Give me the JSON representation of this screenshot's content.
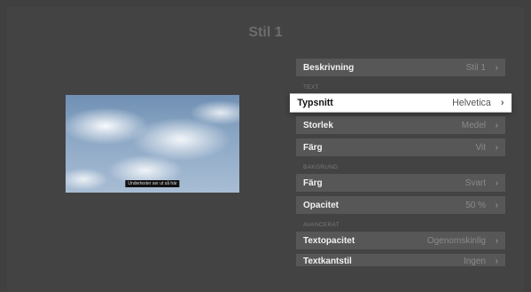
{
  "page": {
    "title": "Stil 1"
  },
  "preview": {
    "subtitle_text": "Undertexter ser ut så här"
  },
  "menu": {
    "description": {
      "label": "Beskrivning",
      "value": "Stil 1"
    },
    "text_section": "TEXT",
    "text_items": [
      {
        "label": "Typsnitt",
        "value": "Helvetica"
      },
      {
        "label": "Storlek",
        "value": "Medel"
      },
      {
        "label": "Färg",
        "value": "Vit"
      }
    ],
    "background_section": "BAKGRUND",
    "background_items": [
      {
        "label": "Färg",
        "value": "Svart"
      },
      {
        "label": "Opacitet",
        "value": "50 %"
      }
    ],
    "advanced_section": "AVANCERAT",
    "advanced_items": [
      {
        "label": "Textopacitet",
        "value": "Ogenomskinlig"
      },
      {
        "label": "Textkantstil",
        "value": "Ingen"
      }
    ]
  },
  "icons": {
    "chevron": "›"
  },
  "colors": {
    "background": "#434343",
    "row": "#575757",
    "focused_row": "#ffffff",
    "muted_text": "#8a8a8a"
  }
}
